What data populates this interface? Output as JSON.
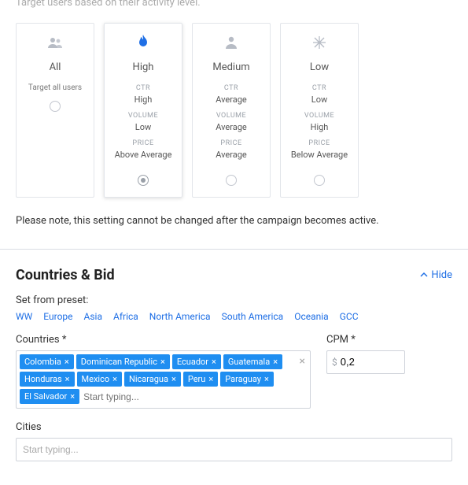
{
  "activity": {
    "top_desc": "Target users based on their activity level.",
    "cards": [
      {
        "title": "All",
        "subtitle": "Target all users",
        "ctr": "",
        "volume": "",
        "price": "",
        "selected": false,
        "icon": "users"
      },
      {
        "title": "High",
        "subtitle": "",
        "ctr": "High",
        "volume": "Low",
        "price": "Above Average",
        "selected": true,
        "icon": "fire"
      },
      {
        "title": "Medium",
        "subtitle": "",
        "ctr": "Average",
        "volume": "Average",
        "price": "Average",
        "selected": false,
        "icon": "person"
      },
      {
        "title": "Low",
        "subtitle": "",
        "ctr": "Low",
        "volume": "High",
        "price": "Below Average",
        "selected": false,
        "icon": "snow"
      }
    ],
    "meta_labels": {
      "ctr": "CTR",
      "volume": "VOLUME",
      "price": "PRICE"
    },
    "note": "Please note, this setting cannot be changed after the campaign becomes active."
  },
  "countries_bid": {
    "heading": "Countries & Bid",
    "hide_label": "Hide",
    "preset_label": "Set from preset:",
    "presets": [
      "WW",
      "Europe",
      "Asia",
      "Africa",
      "North America",
      "South America",
      "Oceania",
      "GCC"
    ],
    "countries_label": "Countries *",
    "countries": [
      "Colombia",
      "Dominican Republic",
      "Ecuador",
      "Guatemala",
      "Honduras",
      "Mexico",
      "Nicaragua",
      "Peru",
      "Paraguay",
      "El Salvador"
    ],
    "countries_placeholder": "Start typing...",
    "cpm_label": "CPM *",
    "cpm_currency": "$",
    "cpm_value": "0,2",
    "cities_label": "Cities",
    "cities_placeholder": "Start typing..."
  }
}
